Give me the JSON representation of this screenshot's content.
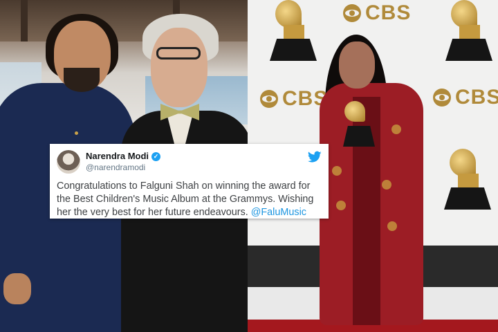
{
  "tweet": {
    "display_name": "Narendra Modi",
    "handle": "@narendramodi",
    "text": "Congratulations to Falguni Shah on winning the award for the Best Children's Music Album at the Grammys. Wishing her the very best for her future endeavours.",
    "mention": "@FaluMusic",
    "verified": true,
    "icon": "twitter-bird-icon",
    "accent_color": "#1da1f2"
  },
  "backdrop": {
    "logo_text": "CBS",
    "logo_color": "#b08a3a"
  }
}
